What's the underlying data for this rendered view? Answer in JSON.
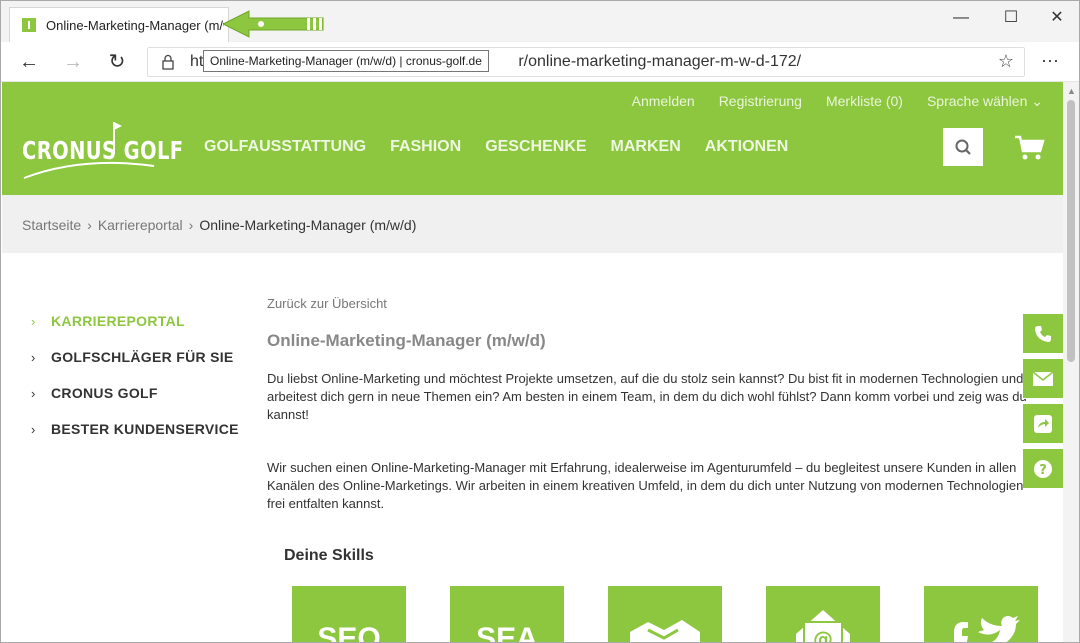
{
  "browser": {
    "tab_title": "Online-Marketing-Manager (m/w/d) | cronus-golf.de",
    "url_start": "ht",
    "url_end": "r/online-marketing-manager-m-w-d-172/",
    "tooltip": "Online-Marketing-Manager (m/w/d) | cronus-golf.de",
    "minimize": "—",
    "maximize": "☐",
    "close": "✕",
    "back": "←",
    "forward": "→",
    "reload": "↻",
    "favorite": "☆",
    "more": "···"
  },
  "header": {
    "logo_text": "CRONUS GOLF",
    "topnav": [
      "Anmelden",
      "Registrierung",
      "Merkliste (0)",
      "Sprache wählen ⌄"
    ],
    "mainnav": [
      "GOLFAUSSTATTUNG",
      "FASHION",
      "GESCHENKE",
      "MARKEN",
      "AKTIONEN"
    ],
    "brand_color": "#8dc63f"
  },
  "breadcrumb": {
    "items": [
      "Startseite",
      "Karriereportal",
      "Online-Marketing-Manager (m/w/d)"
    ],
    "separator": "›"
  },
  "sidebar": {
    "items": [
      {
        "label": "KARRIEREPORTAL",
        "active": true
      },
      {
        "label": "GOLFSCHLÄGER FÜR SIE",
        "active": false
      },
      {
        "label": "CRONUS GOLF",
        "active": false
      },
      {
        "label": "BESTER KUNDENSERVICE",
        "active": false
      }
    ],
    "chevron": "›"
  },
  "main": {
    "back_link": "Zurück zur Übersicht",
    "title": "Online-Marketing-Manager (m/w/d)",
    "paragraph1": "Du liebst Online-Marketing und möchtest Projekte umsetzen, auf die du stolz sein kannst? Du bist fit in modernen Technologien und arbeitest dich gern in neue Themen ein? Am besten in einem Team, in dem du dich wohl fühlst? Dann komm vorbei und zeig was du kannst!",
    "paragraph2": "Wir suchen einen Online-Marketing-Manager mit Erfahrung, idealerweise im Agenturumfeld – du begleitest unsere Kunden in allen Kanälen des Online-Marketings. Wir arbeiten in einem kreativen Umfeld, in dem du dich unter Nutzung von modernen Technologien frei entfalten kannst.",
    "skills_title": "Deine Skills",
    "skills": [
      "SEO",
      "SEA",
      "handshake-icon",
      "email-icon",
      "social-icon"
    ]
  },
  "floating": [
    "phone-icon",
    "mail-icon",
    "share-icon",
    "help-icon"
  ]
}
